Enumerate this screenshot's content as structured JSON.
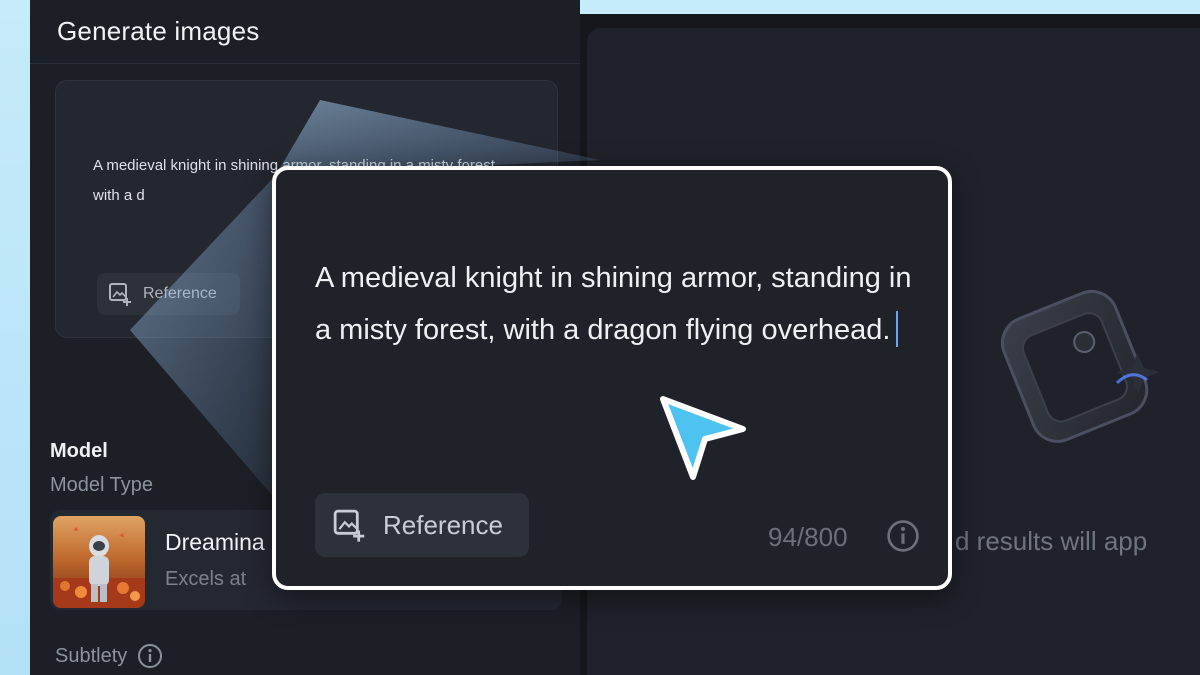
{
  "panel": {
    "title": "Generate images",
    "small_prompt": "A medieval knight in shining armor, standing in a misty forest, with a d",
    "reference_label": "Reference",
    "model_heading": "Model",
    "model_type_label": "Model Type",
    "model_name": "Dreamina",
    "model_desc": "Excels at",
    "subtlety_label": "Subtlety"
  },
  "popup": {
    "prompt": "A medieval knight in shining armor, standing in a misty forest, with a dragon flying overhead.",
    "reference_label": "Reference",
    "char_count": "94/800"
  },
  "results": {
    "placeholder_text": "d results will app"
  },
  "colors": {
    "accent_cursor": "#4fc3f0",
    "caret": "#69a5f0",
    "panel_bg": "#1c1f26",
    "popup_border": "#ffffff"
  },
  "icons": [
    "reference-image-icon",
    "info-icon",
    "image-placeholder-icon",
    "pointer-cursor-icon"
  ]
}
